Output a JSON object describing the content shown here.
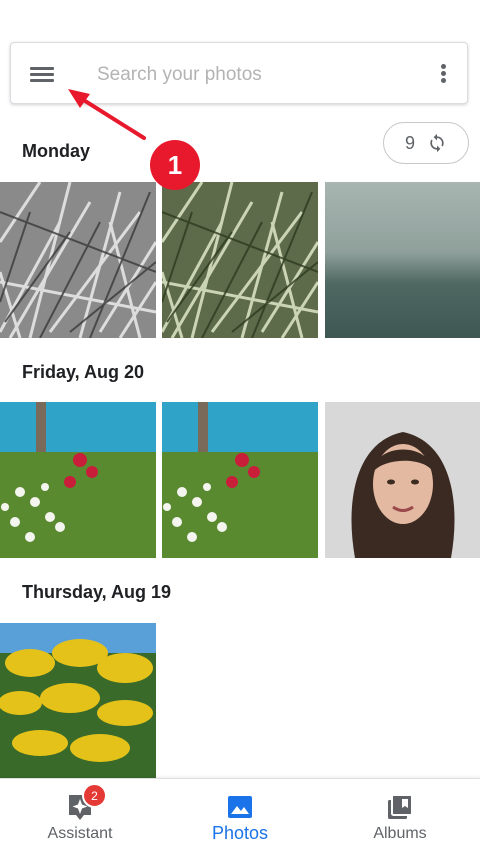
{
  "search": {
    "placeholder": "Search your photos"
  },
  "sync": {
    "count": "9"
  },
  "annotation": {
    "step": "1"
  },
  "sections": [
    {
      "label": "Monday"
    },
    {
      "label": "Friday, Aug 20"
    },
    {
      "label": "Thursday, Aug 19"
    }
  ],
  "bottom_nav": {
    "items": [
      {
        "label": "Assistant",
        "badge": "2"
      },
      {
        "label": "Photos"
      },
      {
        "label": "Albums"
      }
    ]
  },
  "colors": {
    "accent": "#1a73e8",
    "annotation": "#e8192c",
    "badge": "#e53935"
  }
}
